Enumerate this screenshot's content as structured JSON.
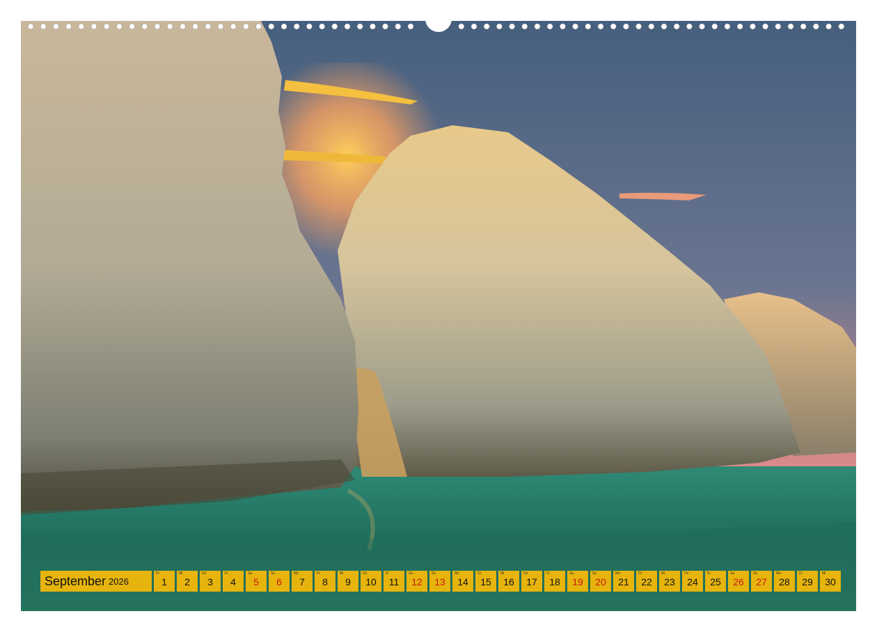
{
  "calendar": {
    "month": "September",
    "year": "2026",
    "days": [
      {
        "n": "1",
        "wd": "Di",
        "weekend": false
      },
      {
        "n": "2",
        "wd": "Mi",
        "weekend": false
      },
      {
        "n": "3",
        "wd": "Do",
        "weekend": false
      },
      {
        "n": "4",
        "wd": "Fr",
        "weekend": false
      },
      {
        "n": "5",
        "wd": "Sa",
        "weekend": true
      },
      {
        "n": "6",
        "wd": "So",
        "weekend": true
      },
      {
        "n": "7",
        "wd": "Mo",
        "weekend": false
      },
      {
        "n": "8",
        "wd": "Di",
        "weekend": false
      },
      {
        "n": "9",
        "wd": "Mi",
        "weekend": false
      },
      {
        "n": "10",
        "wd": "Do",
        "weekend": false
      },
      {
        "n": "11",
        "wd": "Fr",
        "weekend": false
      },
      {
        "n": "12",
        "wd": "Sa",
        "weekend": true
      },
      {
        "n": "13",
        "wd": "So",
        "weekend": true
      },
      {
        "n": "14",
        "wd": "Mo",
        "weekend": false
      },
      {
        "n": "15",
        "wd": "Di",
        "weekend": false
      },
      {
        "n": "16",
        "wd": "Mi",
        "weekend": false
      },
      {
        "n": "17",
        "wd": "Do",
        "weekend": false
      },
      {
        "n": "18",
        "wd": "Fr",
        "weekend": false
      },
      {
        "n": "19",
        "wd": "Sa",
        "weekend": true
      },
      {
        "n": "20",
        "wd": "So",
        "weekend": true
      },
      {
        "n": "21",
        "wd": "Mo",
        "weekend": false
      },
      {
        "n": "22",
        "wd": "Di",
        "weekend": false
      },
      {
        "n": "23",
        "wd": "Mi",
        "weekend": false
      },
      {
        "n": "24",
        "wd": "Do",
        "weekend": false
      },
      {
        "n": "25",
        "wd": "Fr",
        "weekend": false
      },
      {
        "n": "26",
        "wd": "Sa",
        "weekend": true
      },
      {
        "n": "27",
        "wd": "So",
        "weekend": true
      },
      {
        "n": "28",
        "wd": "Mo",
        "weekend": false
      },
      {
        "n": "29",
        "wd": "Di",
        "weekend": false
      },
      {
        "n": "30",
        "wd": "Mi",
        "weekend": false
      }
    ]
  },
  "colors": {
    "bar": "#e6b40d",
    "weekend_text": "#c8190b",
    "sea": "#1f6e5c",
    "sky_top": "#4a6a8a",
    "sky_glow": "#f2a070"
  }
}
